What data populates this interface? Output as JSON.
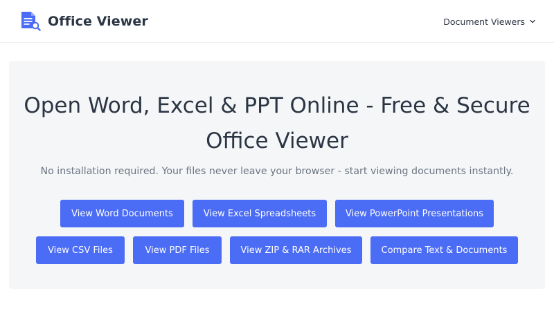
{
  "header": {
    "brand": "Office Viewer",
    "nav": {
      "label": "Document Viewers"
    }
  },
  "hero": {
    "title": "Open Word, Excel & PPT Online - Free & Secure Office Viewer",
    "subtitle": "No installation required. Your files never leave your browser - start viewing documents instantly.",
    "buttons": [
      {
        "label": "View Word Documents"
      },
      {
        "label": "View Excel Spreadsheets"
      },
      {
        "label": "View PowerPoint Presentations"
      },
      {
        "label": "View CSV Files"
      },
      {
        "label": "View PDF Files"
      },
      {
        "label": "View ZIP & RAR Archives"
      },
      {
        "label": "Compare Text & Documents"
      }
    ]
  },
  "colors": {
    "accent": "#4b6cf4",
    "text": "#2b3544",
    "muted": "#6b7480",
    "hero_bg": "#f5f6f8"
  },
  "icons": {
    "logo": "document-search-icon",
    "nav_chevron": "chevron-down-icon"
  }
}
